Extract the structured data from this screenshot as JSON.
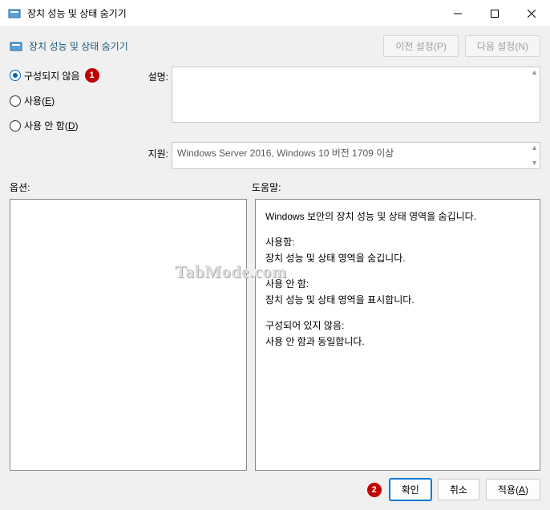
{
  "window": {
    "title": "장치 성능 및 상태 숨기기"
  },
  "header": {
    "title": "장치 성능 및 상태 숨기기",
    "prev_btn": "이전 설정(P)",
    "next_btn": "다음 설정(N)"
  },
  "radios": {
    "not_configured": "구성되지 않음",
    "enabled_prefix": "사용(",
    "enabled_key": "E",
    "enabled_suffix": ")",
    "disabled_prefix": "사용 안 함(",
    "disabled_key": "D",
    "disabled_suffix": ")"
  },
  "labels": {
    "description": "설명:",
    "support": "지원:",
    "options": "옵션:",
    "help": "도움말:"
  },
  "support_text": "Windows Server 2016, Windows 10 버전 1709 이상",
  "help": {
    "intro": "Windows 보안의 장치 성능 및 상태 영역을 숨깁니다.",
    "enabled_h": "사용함:",
    "enabled_t": "장치 성능 및 상태 영역을 숨깁니다.",
    "disabled_h": "사용 안 함:",
    "disabled_t": "장치 성능 및 상태 영역을 표시합니다.",
    "nc_h": "구성되어 있지 않음:",
    "nc_t": "사용 안 함과 동일합니다."
  },
  "footer": {
    "ok": "확인",
    "cancel": "취소",
    "apply_prefix": "적용(",
    "apply_key": "A",
    "apply_suffix": ")"
  },
  "badges": {
    "one": "1",
    "two": "2"
  },
  "watermark": "TabMode.com"
}
